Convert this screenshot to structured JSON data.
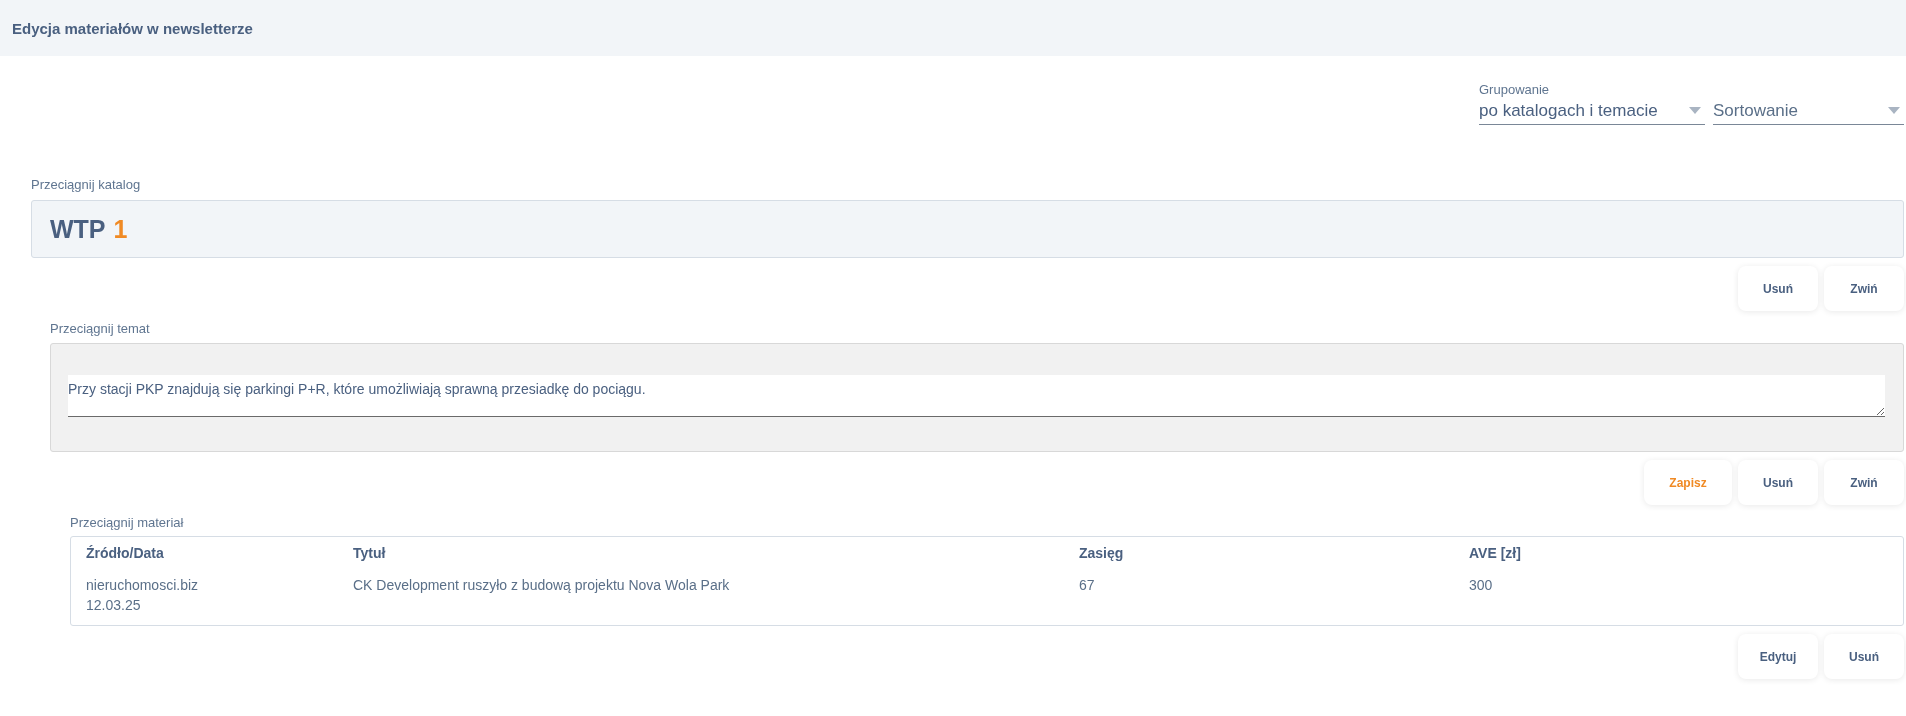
{
  "header": {
    "title": "Edycja materiałów w newsletterze"
  },
  "controls": {
    "grouping": {
      "label": "Grupowanie",
      "value": "po katalogach i temacie"
    },
    "sorting": {
      "placeholder": "Sortowanie"
    }
  },
  "catalog": {
    "drag_label": "Przeciągnij katalog",
    "name": "WTP",
    "count": "1",
    "buttons": [
      {
        "label": "Usuń"
      },
      {
        "label": "Zwiń"
      }
    ]
  },
  "topic": {
    "drag_label": "Przeciągnij temat",
    "text": "Przy stacji PKP znajdują się parkingi P+R, które umożliwiają sprawną przesiadkę do pociągu.",
    "buttons": [
      {
        "label": "Zapisz",
        "kind": "primary"
      },
      {
        "label": "Usuń",
        "kind": "normal"
      },
      {
        "label": "Zwiń",
        "kind": "normal"
      }
    ]
  },
  "material": {
    "drag_label": "Przeciągnij materiał",
    "table": {
      "columns": [
        "Źródło/Data",
        "Tytuł",
        "Zasięg",
        "AVE [zł]"
      ],
      "rows": [
        {
          "source": "nieruchomosci.biz",
          "date": "12.03.25",
          "title": "CK Development ruszyło z budową projektu Nova Wola Park",
          "reach": "67",
          "ave": "300"
        }
      ]
    },
    "buttons": [
      {
        "label": "Edytuj"
      },
      {
        "label": "Usuń"
      }
    ]
  }
}
